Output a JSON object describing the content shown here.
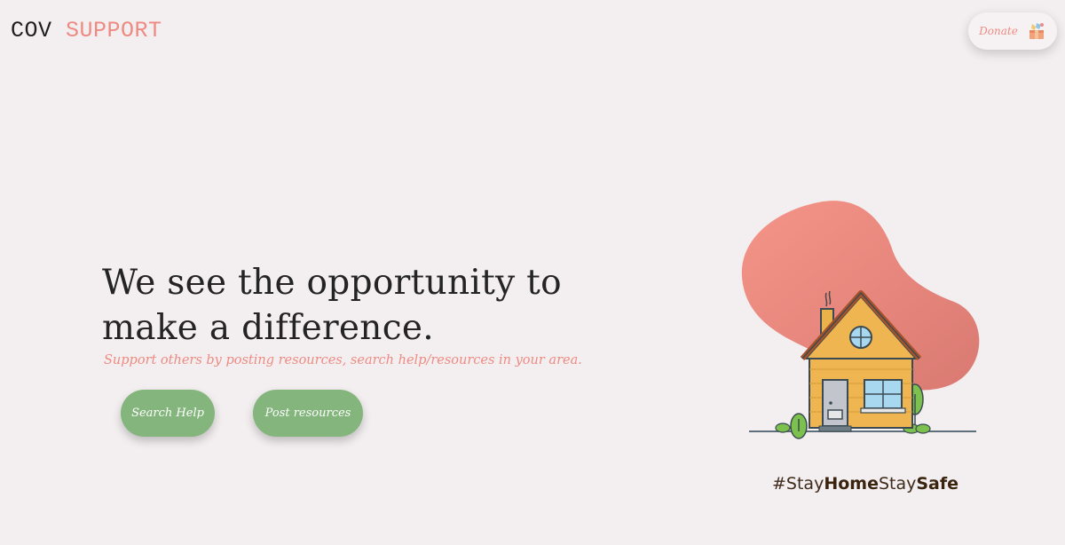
{
  "header": {
    "logo_part1": "COV",
    "logo_part2": "SUPPORT",
    "donate_label": "Donate"
  },
  "hero": {
    "headline_line1": "We see the opportunity to",
    "headline_line2": "make a difference.",
    "subline": "Support others by posting resources, search help/resources in your area.",
    "buttons": {
      "search_help": "Search Help",
      "post_resources": "Post resources"
    }
  },
  "tagline": {
    "part1": "#Stay",
    "part2": "Home",
    "part3": "Stay",
    "part4": "Safe"
  },
  "colors": {
    "background": "#f3eff0",
    "accent_coral": "#ee8a82",
    "button_green": "#83b57c",
    "text_dark": "#242424"
  },
  "icons": [
    "donation-box-icon",
    "house-illustration"
  ]
}
